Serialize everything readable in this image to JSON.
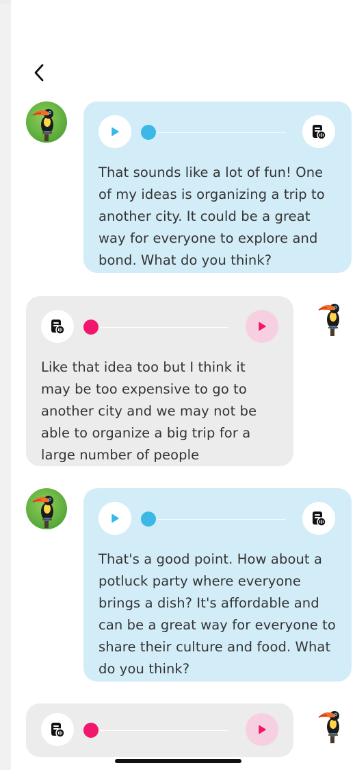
{
  "header": {
    "back_label": "‹"
  },
  "messages": [
    {
      "role": "assistant",
      "text": "That sounds like a lot of fun! One of my ideas is organizing a trip to another city. It could be a great way for everyone to explore and bond. What do you think?"
    },
    {
      "role": "user",
      "text": "Like that idea too but I think it may be too expensive to go to another city and we may not be able to organize a big trip for a large number of people"
    },
    {
      "role": "assistant",
      "text": "That's a good point. How about a potluck party where everyone brings a dish? It's affordable and can be a great way for everyone to share their culture and food. What do you think?"
    },
    {
      "role": "user",
      "text": ""
    }
  ],
  "audio": {
    "assistant_progress": 0.0,
    "user_progress": 0.0
  },
  "colors": {
    "assistant_bubble": "#d3edf8",
    "user_bubble": "#ececec",
    "assistant_accent": "#3bb8e6",
    "user_accent": "#f2166c",
    "user_play_bg": "#f6d0e1"
  },
  "icons": {
    "back": "chevron-left-icon",
    "play": "play-icon",
    "transcript": "transcript-icon",
    "avatar": "toucan-avatar"
  }
}
